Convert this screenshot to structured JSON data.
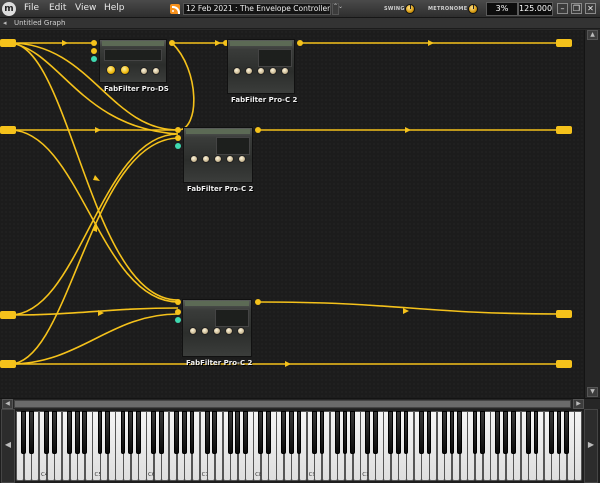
{
  "menu": {
    "logo": "m",
    "items": [
      "File",
      "Edit",
      "View",
      "Help"
    ]
  },
  "news": {
    "headline": "12 Feb 2021 : The Envelope Controller",
    "scroll_glyph": "⌃⌄"
  },
  "transport": {
    "swing_label": "SWING",
    "metronome_label": "METRONOME",
    "swing_value": "3%",
    "tempo": "125.000"
  },
  "window_controls": {
    "minimize": "–",
    "restore": "❐",
    "close": "✕"
  },
  "graph": {
    "title": "Untitled Graph",
    "collapse_glyph": "◂"
  },
  "plugins": [
    {
      "name": "FabFilter Pro-DS"
    },
    {
      "name": "FabFilter Pro-C 2"
    },
    {
      "name": "FabFilter Pro-C 2"
    },
    {
      "name": "FabFilter Pro-C 2"
    }
  ],
  "colors": {
    "wire": "#f5c21b",
    "midi_pin": "#3fd9b0",
    "canvas": "#1c1c1c"
  },
  "scrollbars": {
    "up": "▲",
    "down": "▼",
    "left": "◀",
    "right": "▶"
  },
  "keyboard": {
    "left_arrow": "◀",
    "right_arrow": "▶",
    "octave_labels": [
      "C4",
      "C5",
      "C6",
      "C7",
      "C8",
      "C9",
      "C10"
    ]
  }
}
